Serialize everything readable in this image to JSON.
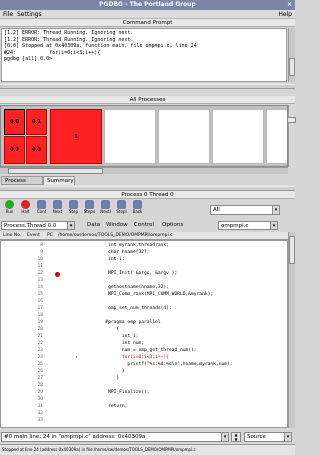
{
  "window": {
    "title": "PGDBG - The Portland Group",
    "close": "×"
  },
  "menu": {
    "file": "File",
    "settings": "Settings",
    "help": "Help"
  },
  "command": {
    "title": "Command Prompt",
    "lines": [
      "[1.2] ERROR: Thread Running. Ignoring next.",
      "[1.2] ERROR: Thread Running. Ignoring next.",
      "[0.0] Stopped at 0x40309a, function main, file ompmpi.c, line 24",
      "#24:           for(i=0;i<3;i++){",
      "",
      "pgdbg [all] 0.0>"
    ]
  },
  "processes": {
    "title": "All Processes",
    "cells": [
      {
        "label": "0.0"
      },
      {
        "label": "0.1"
      },
      {
        "label": "1"
      },
      {
        "label": "0.2"
      },
      {
        "label": "0.3"
      }
    ]
  },
  "tabs": {
    "process_grid": "Process Grid",
    "summary": "Summary"
  },
  "thread_panel": {
    "title": "Process 0 Thread 0"
  },
  "toolbar": {
    "run": "Run",
    "halt": "Halt",
    "cont": "Cont",
    "next": "Next",
    "step": "Step",
    "stepo": "Stepo",
    "nexti": "NextI",
    "stepi": "StepI",
    "back": "Back",
    "scope_value": "All"
  },
  "options": {
    "process_value": "Process.Thread 0.0",
    "data": "Data",
    "window": "Window",
    "control": "Control",
    "options": "Options",
    "file_value": "ompmpi.c"
  },
  "columns": {
    "line_no": "Line No.",
    "event": "Event",
    "pc": "PC",
    "path": "/home/sw/demos/TOOLS_DEMO/OMPMPI/ompmpi.c"
  },
  "code": [
    {
      "ln": "8",
      "src": "    int myrank,threadrank;"
    },
    {
      "ln": "9",
      "src": "    char hname[32];"
    },
    {
      "ln": "10",
      "src": "    int i;"
    },
    {
      "ln": "11",
      "src": ""
    },
    {
      "ln": "12",
      "src": "    MPI_Init( &argc, &argv );",
      "bp": true
    },
    {
      "ln": "13",
      "src": ""
    },
    {
      "ln": "14",
      "src": "    gethostname(hname,32);"
    },
    {
      "ln": "15",
      "src": "    MPI_Comm_rank(MPI_COMM_WORLD,&myrank);"
    },
    {
      "ln": "16",
      "src": ""
    },
    {
      "ln": "17",
      "src": "    omp_set_num_threads(4);"
    },
    {
      "ln": "18",
      "src": ""
    },
    {
      "ln": "19",
      "src": "   #pragma omp parallel"
    },
    {
      "ln": "20",
      "src": "       {"
    },
    {
      "ln": "21",
      "src": "         int i;"
    },
    {
      "ln": "22",
      "src": "         int num;"
    },
    {
      "ln": "23",
      "src": "         num = omp_get_thread_num();"
    },
    {
      "ln": "24",
      "src": "         for(i=0;i<3;i++){",
      "cur": true
    },
    {
      "ln": "25",
      "src": "           printf(\"%s:%d:%d\\n\",hname,myrank,num);"
    },
    {
      "ln": "26",
      "src": "         }"
    },
    {
      "ln": "27",
      "src": "       }"
    },
    {
      "ln": "28",
      "src": ""
    },
    {
      "ln": "29",
      "src": "    MPI_Finalize();"
    },
    {
      "ln": "30",
      "src": ""
    },
    {
      "ln": "31",
      "src": "    return;"
    },
    {
      "ln": "32",
      "src": ""
    },
    {
      "ln": "33",
      "src": ""
    }
  ],
  "bottom": {
    "location_value": "#0 main line: 24 in \"ompmpi.c\" address: 0x40309a",
    "view_value": "Source"
  },
  "status": "Stopped at line 24 (address 0x40309a) in file /home/sw/demos/TOOLS_DEMO/OMPMPI/ompmpi.c"
}
